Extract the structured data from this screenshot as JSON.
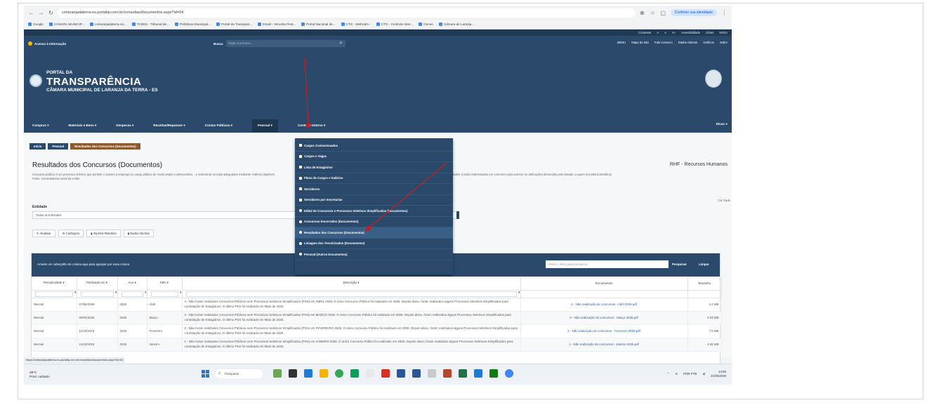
{
  "browser": {
    "url": "cmlaranjadaterra-es.portaltp.com.br/consultas/documentos.aspx?id=64",
    "profile_chip": "Confirme sua identidade",
    "bookmarks": [
      "Google",
      "CÂMARA MUNICIP...",
      "cmlaranjadaterra-es...",
      "TCEES - Tribunal de...",
      "Prefeitura Municipal...",
      "Portal da Transpare...",
      "Email - Verusha Pest...",
      "Portal Nacional de...",
      "CTG - WebAdm -",
      "CTG - Controle Inter...",
      "Genon",
      "Câmara de Laranja..."
    ]
  },
  "site": {
    "access_bar": [
      "Contraste",
      "A",
      "A",
      "A+",
      "Acessibilidade",
      "Libras",
      "NVDA"
    ],
    "access_info": "Acesso à Informação",
    "search_label": "Busca",
    "search_placeholder": "Digite sua busca...",
    "top_links": [
      "MENU",
      "Mapa do Site",
      "Fale Conosco",
      "Dados Abertos",
      "Gráficos",
      "Sobre"
    ],
    "brand_line1": "PORTAL DA",
    "brand_line2": "TRANSPARÊNCIA",
    "brand_line3": "CÂMARA MUNICIPAL DE LARANJA DA TERRA - ES",
    "menu": [
      "Compras",
      "Materiais e Bens",
      "Despesas",
      "Receitas/Repasses",
      "Contas Públicas",
      "Pessoal",
      "Controle Interno"
    ],
    "dicas": "Dicas",
    "breadcrumbs": [
      "Início",
      "Pessoal",
      "Resultados dos Concursos (Documentos)"
    ],
    "page_title": "Resultados dos Concursos (Documentos)",
    "section_tag": "RHF - Recursos Humanos",
    "description": "Concurso público é um processo seletivo que permite o acesso a emprego ou cargo público de modo amplo e democrático... e selecionar os mais adequados mediante critérios objetivos.",
    "description_right": "dades a todos interessados em concorrer para exercer as atribuições oferecidas pelo Estado, a quem incumbirá identificar",
    "source": "Fonte: Controladoria Geral da União",
    "entidade_label": "Entidade",
    "entidade_value": "Todas as Entidades",
    "broken_image_alt": "Cor Cade",
    "toolbar": [
      "Atualizar",
      "Configurar",
      "Imprimir Relatório",
      "Dados Abertos"
    ],
    "grid_group_hint": "Arraste um cabeçalho de coluna aqui para agrupar por essa coluna",
    "grid_search_placeholder": "Insira o texto para pesquisar...",
    "grid_search_btn": "Pesquisar",
    "grid_clear_btn": "Limpar",
    "columns": [
      "Periodicidade",
      "Publicado em",
      "Ano",
      "Mês",
      "Descrição",
      "Documentos",
      "Tamanho"
    ],
    "rows": [
      {
        "periodicidade": "Mensal",
        "publicado": "07/05/2026",
        "ano": "2026",
        "mes": "Abril",
        "descricao": "4 - Não foram realizados Concursos Públicos nem Processos Seletivos Simplificados (PSS) em ABRIL 2026. O único Concurso Público foi realizado em 2006. Depois disso, foram realizados alguns Processos Seletivos Simplificados para contratação de Estagiários. O último PSS foi realizado em Maio de 2025.",
        "documento": "4 - Não realização de concursos - Abril 2026.pdf",
        "tamanho": "4.2 MB"
      },
      {
        "periodicidade": "Mensal",
        "publicado": "06/04/2026",
        "ano": "2026",
        "mes": "Março",
        "descricao": "3 - Não foram realizados Concursos Públicos nem Processos Seletivos Simplificados (PSS) em MARÇO 2026. O único Concurso Público foi realizado em 2006. Depois disso, foram realizados alguns Processos Seletivos Simplificados para contratação de Estagiários. O último PSS foi realizado em Maio de 2025.",
        "documento": "3 - Não realização de concursos - Março 2026.pdf",
        "tamanho": "4.03 MB"
      },
      {
        "periodicidade": "Mensal",
        "publicado": "11/03/2026",
        "ano": "2026",
        "mes": "Fevereiro",
        "descricao": "2 - Não foram realizados Concursos Públicos nem Processos Seletivos Simplificados (PSS) em FEVEREIRO 2026. O único Concurso Público foi realizado em 2006. Depois disso, foram realizados alguns Processos Seletivos Simplificados para contratação de Estagiários. O último PSS foi realizado em Maio de 2025.",
        "documento": "2 - Não realização de concursos - Fevereiro 2026.pdf",
        "tamanho": "7.5 MB"
      },
      {
        "periodicidade": "Mensal",
        "publicado": "11/02/2026",
        "ano": "2026",
        "mes": "Janeiro",
        "descricao": "1 - Não foram realizados Concursos Públicos nem Processos Seletivos Simplificados (PSS) em JANEIRO 2026. O único Concurso Público foi realizado em 2006. Depois disso, foram realizados alguns Processos Seletivos Simplificados para contratação de Estagiários. O último PSS foi realizado em Maio de 2025.",
        "documento": "1 - Não realização de concursos - Janeiro 2026.pdf",
        "tamanho": "4.65 MB"
      }
    ],
    "dropdown": [
      {
        "label": "Cargos Comissionados",
        "icon": "list"
      },
      {
        "label": "Cargos e Vagas",
        "icon": "list"
      },
      {
        "label": "Lista de Estagiários",
        "icon": "list"
      },
      {
        "label": "Plano de Cargos e Salários",
        "icon": "list"
      },
      {
        "label": "Servidores",
        "icon": "list"
      },
      {
        "label": "Servidores por Secretarias",
        "icon": "list"
      },
      {
        "label": "Edital de Concursos e Processos Seletivos Simplificados (Documentos)",
        "icon": "doc"
      },
      {
        "label": "Concursos Encerrados (Documentos)",
        "icon": "doc"
      },
      {
        "label": "Resultados dos Concursos (Documentos)",
        "icon": "doc"
      },
      {
        "label": "Listagem dos Terceirizados (Documentos)",
        "icon": "doc"
      },
      {
        "label": "Pessoal (Outros Documentos)",
        "icon": "doc"
      }
    ],
    "dropdown_highlight_index": 8
  },
  "status_link": "https://cmlaranjadaterra-es.portaltp.com.br/consultas/documentos.aspx?id=64",
  "taskbar": {
    "temp": "29°C",
    "weather": "Pred. nublado",
    "search": "Pesquisar",
    "lang": "POR PTB",
    "time": "14:56",
    "date": "21/05/2026"
  },
  "colors": {
    "site_primary": "#2b4a6b",
    "breadcrumb_current": "#8c5a2c",
    "annotation_arrow": "#c71c22"
  }
}
